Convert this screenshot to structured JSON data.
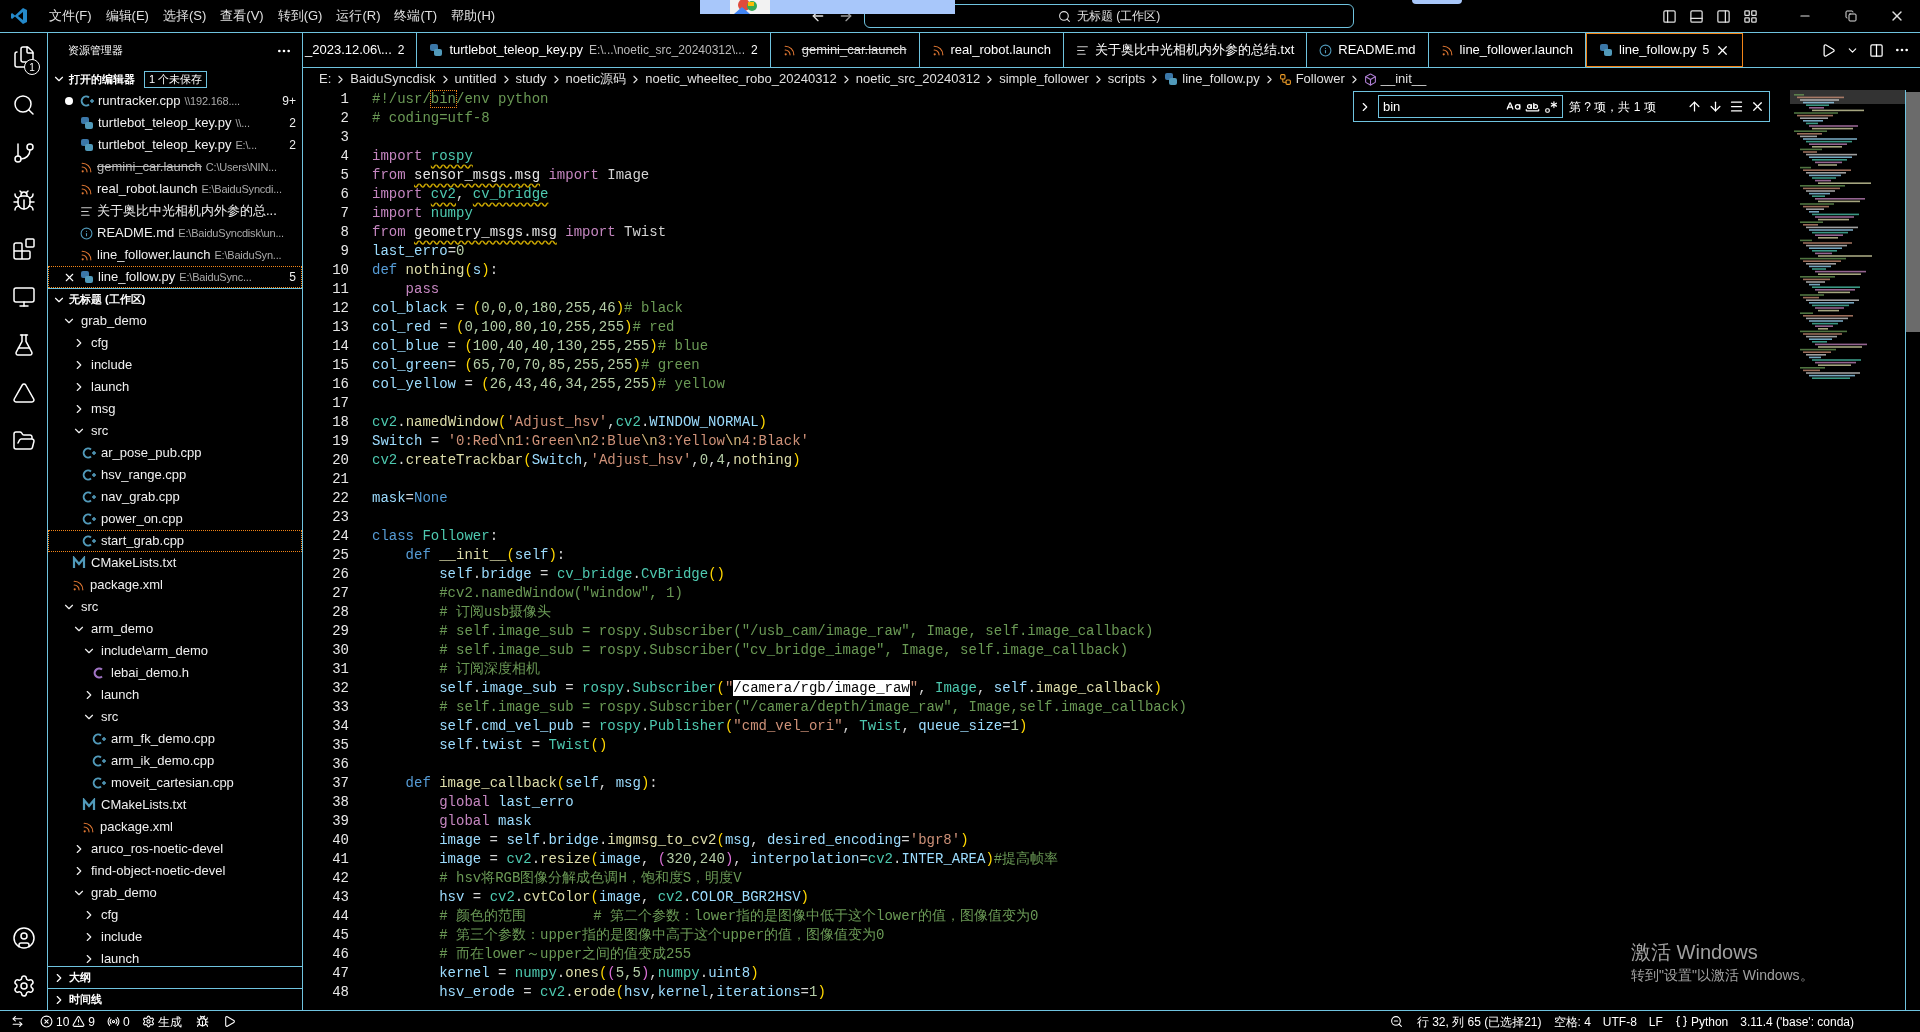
{
  "title_bar": {
    "menus": [
      "文件(F)",
      "编辑(E)",
      "选择(S)",
      "查看(V)",
      "转到(G)",
      "运行(R)",
      "终端(T)",
      "帮助(H)"
    ],
    "command_center": "无标题 (工作区)"
  },
  "activity_bar": {
    "explorer_badge": "1"
  },
  "sidebar": {
    "title": "资源管理器",
    "open_editors": {
      "title": "打开的编辑器",
      "badge": "1 个未保存",
      "expanded": true,
      "items": [
        {
          "name": "runtracker.cpp",
          "path": "\\\\192.168....",
          "kind": "cpp",
          "badge": "9+",
          "dirty": true,
          "deleted": false,
          "selected": false
        },
        {
          "name": "turtlebot_teleop_key.py",
          "path": "\\\\...",
          "kind": "py",
          "badge": "2",
          "dirty": false,
          "deleted": false,
          "selected": false
        },
        {
          "name": "turtlebot_teleop_key.py",
          "path": "E:\\...",
          "kind": "py",
          "badge": "2",
          "dirty": false,
          "deleted": false,
          "selected": false
        },
        {
          "name": "gemini_car.launch",
          "path": "C:\\Users\\NIN...",
          "kind": "rss",
          "dirty": false,
          "deleted": true,
          "selected": false
        },
        {
          "name": "real_robot.launch",
          "path": "E:\\BaiduSyncdi...",
          "kind": "rss",
          "dirty": false,
          "deleted": false,
          "selected": false
        },
        {
          "name": "关于奥比中光相机内外参的总...",
          "kind": "txt",
          "dirty": false,
          "deleted": false,
          "selected": false
        },
        {
          "name": "README.md",
          "path": "E:\\BaiduSyncdisk\\un...",
          "kind": "md",
          "dirty": false,
          "deleted": false,
          "selected": false
        },
        {
          "name": "line_follower.launch",
          "path": "E:\\BaiduSyn...",
          "kind": "rss",
          "dirty": false,
          "deleted": false,
          "selected": false
        },
        {
          "name": "line_follow.py",
          "path": "E:\\BaiduSync...",
          "kind": "py",
          "badge": "5",
          "dirty": false,
          "deleted": false,
          "selected": true
        }
      ]
    },
    "workspace": {
      "title": "无标题 (工作区)",
      "expanded": true,
      "tree": [
        {
          "label": "grab_demo",
          "kind": "folder",
          "expanded": true,
          "selected": false,
          "children": [
            {
              "label": "cfg",
              "kind": "folder",
              "expanded": false,
              "selected": false
            },
            {
              "label": "include",
              "kind": "folder",
              "expanded": false,
              "selected": false
            },
            {
              "label": "launch",
              "kind": "folder",
              "expanded": false,
              "selected": false
            },
            {
              "label": "msg",
              "kind": "folder",
              "expanded": false,
              "selected": false
            },
            {
              "label": "src",
              "kind": "folder",
              "expanded": true,
              "selected": false,
              "children": [
                {
                  "label": "ar_pose_pub.cpp",
                  "kind": "cpp",
                  "selected": false
                },
                {
                  "label": "hsv_range.cpp",
                  "kind": "cpp",
                  "selected": false
                },
                {
                  "label": "nav_grab.cpp",
                  "kind": "cpp",
                  "selected": false
                },
                {
                  "label": "power_on.cpp",
                  "kind": "cpp",
                  "selected": false
                },
                {
                  "label": "start_grab.cpp",
                  "kind": "cpp",
                  "selected": true
                }
              ]
            },
            {
              "label": "CMakeLists.txt",
              "kind": "cmake",
              "selected": false
            },
            {
              "label": "package.xml",
              "kind": "rss",
              "selected": false
            }
          ]
        },
        {
          "label": "src",
          "kind": "folder",
          "expanded": true,
          "selected": false,
          "children": [
            {
              "label": "arm_demo",
              "kind": "folder",
              "expanded": true,
              "selected": false,
              "children": [
                {
                  "label": "include\\arm_demo",
                  "kind": "folder",
                  "expanded": true,
                  "selected": false,
                  "children": [
                    {
                      "label": "lebai_demo.h",
                      "kind": "h",
                      "selected": false
                    }
                  ]
                },
                {
                  "label": "launch",
                  "kind": "folder",
                  "expanded": false,
                  "selected": false
                },
                {
                  "label": "src",
                  "kind": "folder",
                  "expanded": true,
                  "selected": false,
                  "children": [
                    {
                      "label": "arm_fk_demo.cpp",
                      "kind": "cpp",
                      "selected": false
                    },
                    {
                      "label": "arm_ik_demo.cpp",
                      "kind": "cpp",
                      "selected": false
                    },
                    {
                      "label": "moveit_cartesian.cpp",
                      "kind": "cpp",
                      "selected": false
                    }
                  ]
                },
                {
                  "label": "CMakeLists.txt",
                  "kind": "cmake",
                  "selected": false
                },
                {
                  "label": "package.xml",
                  "kind": "rss",
                  "selected": false
                }
              ]
            },
            {
              "label": "aruco_ros-noetic-devel",
              "kind": "folder",
              "expanded": false,
              "selected": false
            },
            {
              "label": "find-object-noetic-devel",
              "kind": "folder",
              "expanded": false,
              "selected": false
            },
            {
              "label": "grab_demo",
              "kind": "folder",
              "expanded": true,
              "selected": false,
              "children": [
                {
                  "label": "cfg",
                  "kind": "folder",
                  "expanded": false,
                  "selected": false
                },
                {
                  "label": "include",
                  "kind": "folder",
                  "expanded": false,
                  "selected": false
                },
                {
                  "label": "launch",
                  "kind": "folder",
                  "expanded": false,
                  "selected": false
                }
              ]
            }
          ]
        }
      ]
    },
    "bottom_sections": [
      {
        "title": "大纲",
        "expanded": false
      },
      {
        "title": "时间线",
        "expanded": false
      }
    ]
  },
  "tabs": [
    {
      "label": "_2023.12.06\\...",
      "badge": "2",
      "selected": false,
      "deleted": false
    },
    {
      "label": "turtlebot_teleop_key.py",
      "path": "E:\\...\\noetic_src_20240312\\...",
      "kind": "py",
      "badge": "2",
      "selected": false,
      "deleted": false
    },
    {
      "label": "gemini_car.launch",
      "kind": "rss",
      "selected": false,
      "deleted": true
    },
    {
      "label": "real_robot.launch",
      "kind": "rss",
      "selected": false,
      "deleted": false
    },
    {
      "label": "关于奥比中光相机内外参的总结.txt",
      "kind": "txt",
      "selected": false,
      "deleted": false
    },
    {
      "label": "README.md",
      "kind": "md",
      "selected": false,
      "deleted": false
    },
    {
      "label": "line_follower.launch",
      "kind": "rss",
      "selected": false,
      "deleted": false
    },
    {
      "label": "line_follow.py",
      "kind": "py",
      "badge": "5",
      "selected": true,
      "deleted": false
    }
  ],
  "breadcrumb": [
    {
      "label": "E:"
    },
    {
      "label": "BaiduSyncdisk"
    },
    {
      "label": "untitled"
    },
    {
      "label": "study"
    },
    {
      "label": "noetic源码"
    },
    {
      "label": "noetic_wheeltec_robo_20240312"
    },
    {
      "label": "noetic_src_20240312"
    },
    {
      "label": "simple_follower"
    },
    {
      "label": "scripts"
    },
    {
      "label": "line_follow.py",
      "kind": "py"
    },
    {
      "label": "Follower",
      "kind": "class"
    },
    {
      "label": "__init__",
      "kind": "method"
    }
  ],
  "find_widget": {
    "query": "bin",
    "result": "第 ? 项，共 1 项"
  },
  "code": [
    {
      "number": "1",
      "tokens": [
        {
          "text": "#!/usr/",
          "kind": "cm"
        },
        {
          "text": "bin",
          "kind": "match"
        },
        {
          "text": "/env python",
          "kind": "cm"
        }
      ]
    },
    {
      "number": "2",
      "tokens": [
        {
          "text": "# coding=utf-8",
          "kind": "cm"
        }
      ]
    },
    {
      "number": "3"
    },
    {
      "number": "4",
      "tokens": [
        {
          "text": "import ",
          "kind": "kw"
        },
        {
          "text": "rospy",
          "kind": "modw"
        }
      ]
    },
    {
      "number": "5",
      "tokens": [
        {
          "text": "from ",
          "kind": "kw"
        },
        {
          "text": "sensor_msgs.msg",
          "kind": "w"
        },
        {
          "text": " import ",
          "kind": "kw"
        },
        {
          "text": "Image",
          "kind": "p"
        }
      ]
    },
    {
      "number": "6",
      "tokens": [
        {
          "text": "import ",
          "kind": "kw"
        },
        {
          "text": "cv2",
          "kind": "modw"
        },
        {
          "text": ", ",
          "kind": "p"
        },
        {
          "text": "cv_bridge",
          "kind": "modw"
        }
      ]
    },
    {
      "number": "7",
      "tokens": [
        {
          "text": "import ",
          "kind": "kw"
        },
        {
          "text": "numpy",
          "kind": "mod"
        }
      ]
    },
    {
      "number": "8",
      "tokens": [
        {
          "text": "from ",
          "kind": "kw"
        },
        {
          "text": "geometry_msgs.msg",
          "kind": "w"
        },
        {
          "text": " import ",
          "kind": "kw"
        },
        {
          "text": "Twist",
          "kind": "p"
        }
      ]
    },
    {
      "number": "9",
      "tokens": [
        {
          "text": "last_erro",
          "kind": "var"
        },
        {
          "text": "=",
          "kind": "p"
        },
        {
          "text": "0",
          "kind": "num"
        }
      ]
    },
    {
      "number": "10",
      "tokens": [
        {
          "text": "def ",
          "kind": "def"
        },
        {
          "text": "nothing",
          "kind": "fn"
        },
        {
          "text": "(",
          "kind": "br"
        },
        {
          "text": "s",
          "kind": "var"
        },
        {
          "text": ")",
          "kind": "br"
        },
        {
          "text": ":",
          "kind": "p"
        }
      ]
    },
    {
      "number": "11",
      "tokens": [
        {
          "text": "    pass",
          "kind": "kw"
        }
      ]
    },
    {
      "number": "12",
      "tokens": [
        {
          "text": "col_black",
          "kind": "var"
        },
        {
          "text": " = ",
          "kind": "p"
        },
        {
          "text": "(",
          "kind": "br"
        },
        {
          "text": "0,0,0,180,255,46",
          "kind": "num"
        },
        {
          "text": ")",
          "kind": "br"
        },
        {
          "text": "# black",
          "kind": "cm"
        }
      ]
    },
    {
      "number": "13",
      "tokens": [
        {
          "text": "col_red",
          "kind": "var"
        },
        {
          "text": " = ",
          "kind": "p"
        },
        {
          "text": "(",
          "kind": "br"
        },
        {
          "text": "0,100,80,10,255,255",
          "kind": "num"
        },
        {
          "text": ")",
          "kind": "br"
        },
        {
          "text": "# red",
          "kind": "cm"
        }
      ]
    },
    {
      "number": "14",
      "tokens": [
        {
          "text": "col_blue",
          "kind": "var"
        },
        {
          "text": " = ",
          "kind": "p"
        },
        {
          "text": "(",
          "kind": "br"
        },
        {
          "text": "100,40,40,130,255,255",
          "kind": "num"
        },
        {
          "text": ")",
          "kind": "br"
        },
        {
          "text": "# blue",
          "kind": "cm"
        }
      ]
    },
    {
      "number": "15",
      "tokens": [
        {
          "text": "col_green",
          "kind": "var"
        },
        {
          "text": "= ",
          "kind": "p"
        },
        {
          "text": "(",
          "kind": "br"
        },
        {
          "text": "65,70,70,85,255,255",
          "kind": "num"
        },
        {
          "text": ")",
          "kind": "br"
        },
        {
          "text": "# green",
          "kind": "cm"
        }
      ]
    },
    {
      "number": "16",
      "tokens": [
        {
          "text": "col_yellow",
          "kind": "var"
        },
        {
          "text": " = ",
          "kind": "p"
        },
        {
          "text": "(",
          "kind": "br"
        },
        {
          "text": "26,43,46,34,255,255",
          "kind": "num"
        },
        {
          "text": ")",
          "kind": "br"
        },
        {
          "text": "# yellow",
          "kind": "cm"
        }
      ]
    },
    {
      "number": "17"
    },
    {
      "number": "18",
      "tokens": [
        {
          "text": "cv2",
          "kind": "mod"
        },
        {
          "text": ".",
          "kind": "p"
        },
        {
          "text": "namedWindow",
          "kind": "fn"
        },
        {
          "text": "(",
          "kind": "br"
        },
        {
          "text": "'Adjust_hsv'",
          "kind": "str"
        },
        {
          "text": ",",
          "kind": "p"
        },
        {
          "text": "cv2",
          "kind": "mod"
        },
        {
          "text": ".",
          "kind": "p"
        },
        {
          "text": "WINDOW_NORMAL",
          "kind": "var"
        },
        {
          "text": ")",
          "kind": "br"
        }
      ]
    },
    {
      "number": "19",
      "tokens": [
        {
          "text": "Switch",
          "kind": "var"
        },
        {
          "text": " = ",
          "kind": "p"
        },
        {
          "text": "'0:Red",
          "kind": "str"
        },
        {
          "text": "\\n",
          "kind": "esc"
        },
        {
          "text": "1:Green",
          "kind": "str"
        },
        {
          "text": "\\n",
          "kind": "esc"
        },
        {
          "text": "2:Blue",
          "kind": "str"
        },
        {
          "text": "\\n",
          "kind": "esc"
        },
        {
          "text": "3:Yellow",
          "kind": "str"
        },
        {
          "text": "\\n",
          "kind": "esc"
        },
        {
          "text": "4:Black'",
          "kind": "str"
        }
      ]
    },
    {
      "number": "20",
      "tokens": [
        {
          "text": "cv2",
          "kind": "mod"
        },
        {
          "text": ".",
          "kind": "p"
        },
        {
          "text": "createTrackbar",
          "kind": "fn"
        },
        {
          "text": "(",
          "kind": "br"
        },
        {
          "text": "Switch",
          "kind": "var"
        },
        {
          "text": ",",
          "kind": "p"
        },
        {
          "text": "'Adjust_hsv'",
          "kind": "str"
        },
        {
          "text": ",",
          "kind": "p"
        },
        {
          "text": "0",
          "kind": "num"
        },
        {
          "text": ",",
          "kind": "p"
        },
        {
          "text": "4",
          "kind": "num"
        },
        {
          "text": ",",
          "kind": "p"
        },
        {
          "text": "nothing",
          "kind": "fn"
        },
        {
          "text": ")",
          "kind": "br"
        }
      ]
    },
    {
      "number": "21"
    },
    {
      "number": "22",
      "tokens": [
        {
          "text": "mask",
          "kind": "var"
        },
        {
          "text": "=",
          "kind": "p"
        },
        {
          "text": "None",
          "kind": "def"
        }
      ]
    },
    {
      "number": "23"
    },
    {
      "number": "24",
      "tokens": [
        {
          "text": "class ",
          "kind": "def"
        },
        {
          "text": "Follower",
          "kind": "cls"
        },
        {
          "text": ":",
          "kind": "p"
        }
      ]
    },
    {
      "number": "25",
      "tokens": [
        {
          "text": "    def ",
          "kind": "def"
        },
        {
          "text": "__init__",
          "kind": "fn"
        },
        {
          "text": "(",
          "kind": "br"
        },
        {
          "text": "self",
          "kind": "var"
        },
        {
          "text": ")",
          "kind": "br"
        },
        {
          "text": ":",
          "kind": "p"
        }
      ]
    },
    {
      "number": "26",
      "tokens": [
        {
          "text": "        self",
          "kind": "var"
        },
        {
          "text": ".",
          "kind": "p"
        },
        {
          "text": "bridge",
          "kind": "var"
        },
        {
          "text": " = ",
          "kind": "p"
        },
        {
          "text": "cv_bridge",
          "kind": "mod"
        },
        {
          "text": ".",
          "kind": "p"
        },
        {
          "text": "CvBridge",
          "kind": "cls"
        },
        {
          "text": "()",
          "kind": "br"
        }
      ]
    },
    {
      "number": "27",
      "tokens": [
        {
          "text": "        #cv2.namedWindow(\"window\", 1)",
          "kind": "cm"
        }
      ]
    },
    {
      "number": "28",
      "tokens": [
        {
          "text": "        # 订阅usb摄像头",
          "kind": "cm"
        }
      ]
    },
    {
      "number": "29",
      "tokens": [
        {
          "text": "        # self.image_sub = rospy.Subscriber(\"/usb_cam/image_raw\", Image, self.image_callback)",
          "kind": "cm"
        }
      ]
    },
    {
      "number": "30",
      "tokens": [
        {
          "text": "        # self.image_sub = rospy.Subscriber(\"cv_bridge_image\", Image, self.image_callback)",
          "kind": "cm"
        }
      ]
    },
    {
      "number": "31",
      "tokens": [
        {
          "text": "        # 订阅深度相机",
          "kind": "cm"
        }
      ]
    },
    {
      "number": "32",
      "tokens": [
        {
          "text": "        self",
          "kind": "var"
        },
        {
          "text": ".",
          "kind": "p"
        },
        {
          "text": "image_sub",
          "kind": "var"
        },
        {
          "text": " = ",
          "kind": "p"
        },
        {
          "text": "rospy",
          "kind": "mod"
        },
        {
          "text": ".",
          "kind": "p"
        },
        {
          "text": "Subscriber",
          "kind": "cls"
        },
        {
          "text": "(",
          "kind": "br"
        },
        {
          "text": "\"",
          "kind": "str"
        },
        {
          "text": "/camera/rgb/image_raw",
          "kind": "sel"
        },
        {
          "text": "\"",
          "kind": "str"
        },
        {
          "text": ", ",
          "kind": "p"
        },
        {
          "text": "Image",
          "kind": "cls"
        },
        {
          "text": ", ",
          "kind": "p"
        },
        {
          "text": "self",
          "kind": "var"
        },
        {
          "text": ".",
          "kind": "p"
        },
        {
          "text": "image_callback",
          "kind": "fn"
        },
        {
          "text": ")",
          "kind": "br"
        }
      ]
    },
    {
      "number": "33",
      "tokens": [
        {
          "text": "        # self.image_sub = rospy.Subscriber(\"/camera/depth/image_raw\", Image,self.image_callback)",
          "kind": "cm"
        }
      ]
    },
    {
      "number": "34",
      "tokens": [
        {
          "text": "        self",
          "kind": "var"
        },
        {
          "text": ".",
          "kind": "p"
        },
        {
          "text": "cmd_vel_pub",
          "kind": "var"
        },
        {
          "text": " = ",
          "kind": "p"
        },
        {
          "text": "rospy",
          "kind": "mod"
        },
        {
          "text": ".",
          "kind": "p"
        },
        {
          "text": "Publisher",
          "kind": "cls"
        },
        {
          "text": "(",
          "kind": "br"
        },
        {
          "text": "\"cmd_vel_ori\"",
          "kind": "str"
        },
        {
          "text": ", ",
          "kind": "p"
        },
        {
          "text": "Twist",
          "kind": "cls"
        },
        {
          "text": ", ",
          "kind": "p"
        },
        {
          "text": "queue_size",
          "kind": "var"
        },
        {
          "text": "=",
          "kind": "p"
        },
        {
          "text": "1",
          "kind": "num"
        },
        {
          "text": ")",
          "kind": "br"
        }
      ]
    },
    {
      "number": "35",
      "tokens": [
        {
          "text": "        self",
          "kind": "var"
        },
        {
          "text": ".",
          "kind": "p"
        },
        {
          "text": "twist",
          "kind": "var"
        },
        {
          "text": " = ",
          "kind": "p"
        },
        {
          "text": "Twist",
          "kind": "cls"
        },
        {
          "text": "()",
          "kind": "br"
        }
      ]
    },
    {
      "number": "36"
    },
    {
      "number": "37",
      "tokens": [
        {
          "text": "    def ",
          "kind": "def"
        },
        {
          "text": "image_callback",
          "kind": "fn"
        },
        {
          "text": "(",
          "kind": "br"
        },
        {
          "text": "self",
          "kind": "var"
        },
        {
          "text": ", ",
          "kind": "p"
        },
        {
          "text": "msg",
          "kind": "var"
        },
        {
          "text": ")",
          "kind": "br"
        },
        {
          "text": ":",
          "kind": "p"
        }
      ]
    },
    {
      "number": "38",
      "tokens": [
        {
          "text": "        global ",
          "kind": "kw"
        },
        {
          "text": "last_erro",
          "kind": "var"
        }
      ]
    },
    {
      "number": "39",
      "tokens": [
        {
          "text": "        global ",
          "kind": "kw"
        },
        {
          "text": "mask",
          "kind": "var"
        }
      ]
    },
    {
      "number": "40",
      "tokens": [
        {
          "text": "        image",
          "kind": "var"
        },
        {
          "text": " = ",
          "kind": "p"
        },
        {
          "text": "self",
          "kind": "var"
        },
        {
          "text": ".",
          "kind": "p"
        },
        {
          "text": "bridge",
          "kind": "var"
        },
        {
          "text": ".",
          "kind": "p"
        },
        {
          "text": "imgmsg_to_cv2",
          "kind": "fn"
        },
        {
          "text": "(",
          "kind": "br"
        },
        {
          "text": "msg",
          "kind": "var"
        },
        {
          "text": ", ",
          "kind": "p"
        },
        {
          "text": "desired_encoding",
          "kind": "var"
        },
        {
          "text": "=",
          "kind": "p"
        },
        {
          "text": "'bgr8'",
          "kind": "str"
        },
        {
          "text": ")",
          "kind": "br"
        }
      ]
    },
    {
      "number": "41",
      "tokens": [
        {
          "text": "        image",
          "kind": "var"
        },
        {
          "text": " = ",
          "kind": "p"
        },
        {
          "text": "cv2",
          "kind": "mod"
        },
        {
          "text": ".",
          "kind": "p"
        },
        {
          "text": "resize",
          "kind": "fn"
        },
        {
          "text": "(",
          "kind": "br"
        },
        {
          "text": "image",
          "kind": "var"
        },
        {
          "text": ", ",
          "kind": "p"
        },
        {
          "text": "(",
          "kind": "br2"
        },
        {
          "text": "320,240",
          "kind": "num"
        },
        {
          "text": ")",
          "kind": "br2"
        },
        {
          "text": ", ",
          "kind": "p"
        },
        {
          "text": "interpolation",
          "kind": "var"
        },
        {
          "text": "=",
          "kind": "p"
        },
        {
          "text": "cv2",
          "kind": "mod"
        },
        {
          "text": ".",
          "kind": "p"
        },
        {
          "text": "INTER_AREA",
          "kind": "var"
        },
        {
          "text": ")",
          "kind": "br"
        },
        {
          "text": "#提高帧率",
          "kind": "cm"
        }
      ]
    },
    {
      "number": "42",
      "tokens": [
        {
          "text": "        # hsv将RGB图像分解成色调H，饱和度S，明度V",
          "kind": "cm"
        }
      ]
    },
    {
      "number": "43",
      "tokens": [
        {
          "text": "        hsv",
          "kind": "var"
        },
        {
          "text": " = ",
          "kind": "p"
        },
        {
          "text": "cv2",
          "kind": "mod"
        },
        {
          "text": ".",
          "kind": "p"
        },
        {
          "text": "cvtColor",
          "kind": "fn"
        },
        {
          "text": "(",
          "kind": "br"
        },
        {
          "text": "image",
          "kind": "var"
        },
        {
          "text": ", ",
          "kind": "p"
        },
        {
          "text": "cv2",
          "kind": "mod"
        },
        {
          "text": ".",
          "kind": "p"
        },
        {
          "text": "COLOR_BGR2HSV",
          "kind": "var"
        },
        {
          "text": ")",
          "kind": "br"
        }
      ]
    },
    {
      "number": "44",
      "tokens": [
        {
          "text": "        # 颜色的范围        # 第二个参数：lower指的是图像中低于这个lower的值，图像值变为0",
          "kind": "cm"
        }
      ]
    },
    {
      "number": "45",
      "tokens": [
        {
          "text": "        # 第三个参数：upper指的是图像中高于这个upper的值，图像值变为0",
          "kind": "cm"
        }
      ]
    },
    {
      "number": "46",
      "tokens": [
        {
          "text": "        # 而在lower～upper之间的值变成255",
          "kind": "cm"
        }
      ]
    },
    {
      "number": "47",
      "tokens": [
        {
          "text": "        kernel",
          "kind": "var"
        },
        {
          "text": " = ",
          "kind": "p"
        },
        {
          "text": "numpy",
          "kind": "mod"
        },
        {
          "text": ".",
          "kind": "p"
        },
        {
          "text": "ones",
          "kind": "fn"
        },
        {
          "text": "(",
          "kind": "br"
        },
        {
          "text": "(",
          "kind": "br2"
        },
        {
          "text": "5,5",
          "kind": "num"
        },
        {
          "text": ")",
          "kind": "br2"
        },
        {
          "text": ",",
          "kind": "p"
        },
        {
          "text": "numpy",
          "kind": "mod"
        },
        {
          "text": ".",
          "kind": "p"
        },
        {
          "text": "uint8",
          "kind": "var"
        },
        {
          "text": ")",
          "kind": "br"
        }
      ]
    },
    {
      "number": "48",
      "tokens": [
        {
          "text": "        hsv_erode",
          "kind": "var"
        },
        {
          "text": " = ",
          "kind": "p"
        },
        {
          "text": "cv2",
          "kind": "mod"
        },
        {
          "text": ".",
          "kind": "p"
        },
        {
          "text": "erode",
          "kind": "fn"
        },
        {
          "text": "(",
          "kind": "br"
        },
        {
          "text": "hsv",
          "kind": "var"
        },
        {
          "text": ",",
          "kind": "p"
        },
        {
          "text": "kernel",
          "kind": "var"
        },
        {
          "text": ",",
          "kind": "p"
        },
        {
          "text": "iterations",
          "kind": "var"
        },
        {
          "text": "=",
          "kind": "p"
        },
        {
          "text": "1",
          "kind": "num"
        },
        {
          "text": ")",
          "kind": "br"
        }
      ]
    }
  ],
  "activation_notice": {
    "title": "激活 Windows",
    "subtitle": "转到\"设置\"以激活 Windows。"
  },
  "status_bar": {
    "errors": "10",
    "warnings": "9",
    "ports": "0",
    "build": "生成",
    "position": "行 32, 列 65 (已选择21)",
    "indent": "空格: 4",
    "encoding": "UTF-8",
    "eol": "LF",
    "language": "Python",
    "interpreter": "3.11.4 ('base': conda)"
  }
}
